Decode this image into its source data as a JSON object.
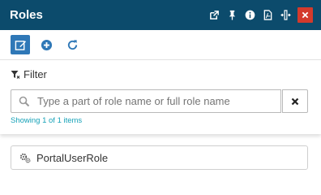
{
  "panel": {
    "title": "Roles",
    "header_icons": [
      "popout-icon",
      "pin-icon",
      "info-icon",
      "pdf-icon",
      "resize-horizontal-icon",
      "close-icon"
    ]
  },
  "toolbar": {
    "buttons": [
      "edit-icon",
      "add-icon",
      "refresh-icon"
    ]
  },
  "filter": {
    "label": "Filter",
    "search_placeholder": "Type a part of role name or full role name",
    "search_value": "",
    "showing_text": "Showing 1 of 1 items"
  },
  "roles": [
    {
      "name": "PortalUserRole",
      "icon": "gears-icon"
    }
  ],
  "colors": {
    "header_bg": "#0c4b6c",
    "close_bg": "#d33a2c",
    "active_tool_bg": "#2f78b7",
    "tool_icon": "#2f78b7",
    "showing_text": "#17a2b8"
  }
}
